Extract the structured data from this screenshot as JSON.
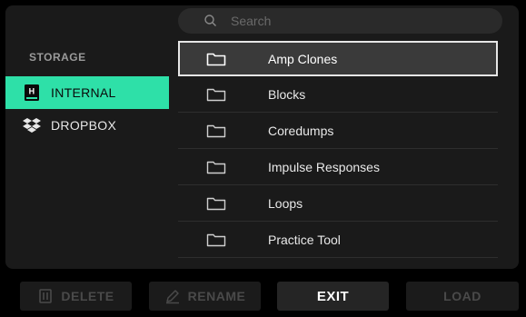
{
  "search": {
    "placeholder": "Search"
  },
  "sidebar": {
    "header": "STORAGE",
    "items": [
      {
        "label": "INTERNAL",
        "icon": "helix-device-icon",
        "selected": true
      },
      {
        "label": "DROPBOX",
        "icon": "dropbox-icon",
        "selected": false
      }
    ]
  },
  "files": [
    {
      "name": "Amp Clones",
      "icon": "folder-icon",
      "selected": true
    },
    {
      "name": "Blocks",
      "icon": "folder-icon",
      "selected": false
    },
    {
      "name": "Coredumps",
      "icon": "folder-icon",
      "selected": false
    },
    {
      "name": "Impulse Responses",
      "icon": "folder-icon",
      "selected": false
    },
    {
      "name": "Loops",
      "icon": "folder-icon",
      "selected": false
    },
    {
      "name": "Practice Tool",
      "icon": "folder-icon",
      "selected": false
    }
  ],
  "buttons": {
    "delete": {
      "label": "DELETE",
      "icon": "trash-icon",
      "enabled": false
    },
    "rename": {
      "label": "RENAME",
      "icon": "pencil-icon",
      "enabled": false
    },
    "exit": {
      "label": "EXIT",
      "enabled": true
    },
    "load": {
      "label": "LOAD",
      "enabled": false
    }
  },
  "colors": {
    "accent": "#2ee0a8",
    "background": "#000000",
    "panel": "#1a1a1a",
    "selected_row": "#3a3a3a",
    "disabled_text": "#4a4a4a"
  }
}
